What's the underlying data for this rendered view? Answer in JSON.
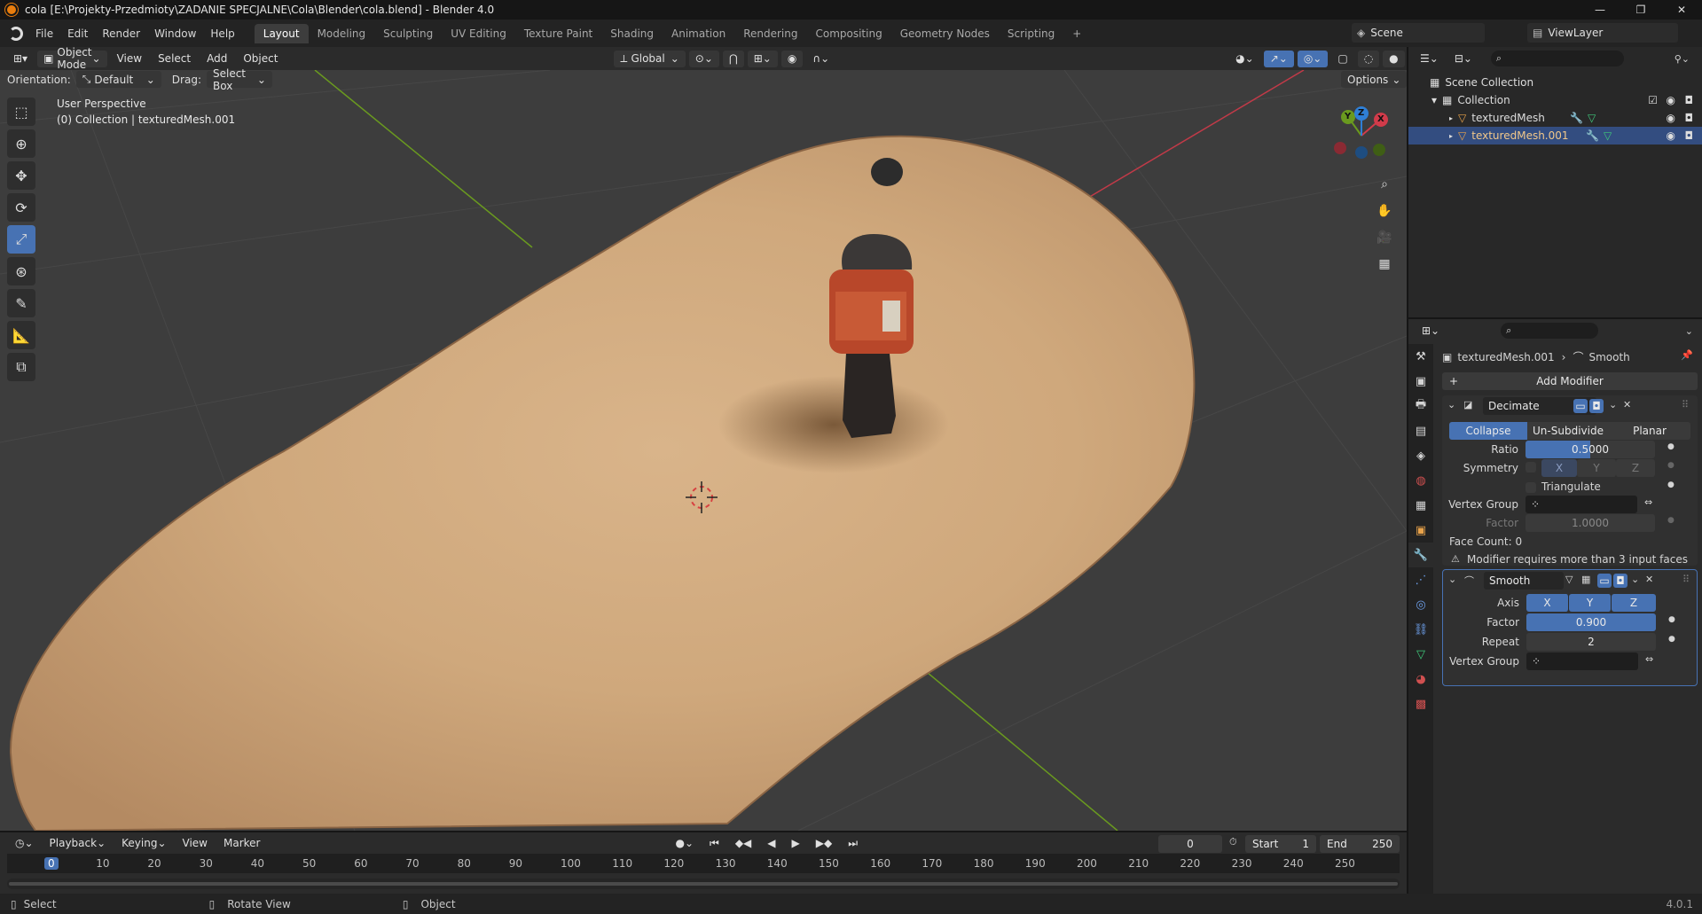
{
  "window": {
    "title": "cola [E:\\Projekty-Przedmioty\\ZADANIE SPECJALNE\\Cola\\Blender\\cola.blend] - Blender 4.0",
    "controls": [
      "—",
      "❐",
      "✕"
    ]
  },
  "menu": [
    "File",
    "Edit",
    "Render",
    "Window",
    "Help"
  ],
  "workspaces": [
    "Layout",
    "Modeling",
    "Sculpting",
    "UV Editing",
    "Texture Paint",
    "Shading",
    "Animation",
    "Rendering",
    "Compositing",
    "Geometry Nodes",
    "Scripting"
  ],
  "active_workspace": "Layout",
  "scene": "Scene",
  "view_layer": "ViewLayer",
  "viewport_header": {
    "mode": "Object Mode",
    "menus": [
      "View",
      "Select",
      "Add",
      "Object"
    ],
    "transform": "Global",
    "orientation_label": "Orientation:",
    "orientation": "Default",
    "drag_label": "Drag:",
    "drag": "Select Box",
    "options": "Options"
  },
  "viewport_info": {
    "view": "User Perspective",
    "collection": "(0) Collection | texturedMesh.001"
  },
  "gizmo": {
    "x": "X",
    "y": "Y",
    "z": "Z"
  },
  "outliner": {
    "root": "Scene Collection",
    "collection": "Collection",
    "items": [
      {
        "name": "texturedMesh",
        "selected": false
      },
      {
        "name": "texturedMesh.001",
        "selected": true
      }
    ]
  },
  "properties": {
    "breadcrumb_object": "texturedMesh.001",
    "breadcrumb_modifier": "Smooth",
    "add_modifier": "Add Modifier",
    "decimate": {
      "name": "Decimate",
      "tabs": [
        "Collapse",
        "Un-Subdivide",
        "Planar"
      ],
      "active_tab": "Collapse",
      "ratio_label": "Ratio",
      "ratio": "0.5000",
      "ratio_fraction": 0.5,
      "symmetry_label": "Symmetry",
      "axes": [
        "X",
        "Y",
        "Z"
      ],
      "triangulate": "Triangulate",
      "vertex_group_label": "Vertex Group",
      "factor_label": "Factor",
      "factor": "1.0000",
      "face_count": "Face Count: 0",
      "warning": "Modifier requires more than 3 input faces"
    },
    "smooth": {
      "name": "Smooth",
      "axis_label": "Axis",
      "axes": [
        "X",
        "Y",
        "Z"
      ],
      "factor_label": "Factor",
      "factor": "0.900",
      "repeat_label": "Repeat",
      "repeat": "2",
      "vertex_group_label": "Vertex Group"
    }
  },
  "timeline": {
    "menus": [
      "Playback",
      "Keying",
      "View",
      "Marker"
    ],
    "current_frame": "0",
    "start_label": "Start",
    "start": "1",
    "end_label": "End",
    "end": "250",
    "ruler": [
      "0",
      "10",
      "20",
      "30",
      "40",
      "50",
      "60",
      "70",
      "80",
      "90",
      "100",
      "110",
      "120",
      "130",
      "140",
      "150",
      "160",
      "170",
      "180",
      "190",
      "200",
      "210",
      "220",
      "230",
      "240",
      "250"
    ]
  },
  "statusbar": {
    "select": "Select",
    "rotate": "Rotate View",
    "object": "Object",
    "version": "4.0.1"
  },
  "colors": {
    "accent_blue": "#4772b3",
    "viewport_bg": "#3d3d3d",
    "axis_red": "#d13b4a",
    "axis_green": "#6a9a1f",
    "axis_blue": "#2f7fd6"
  }
}
